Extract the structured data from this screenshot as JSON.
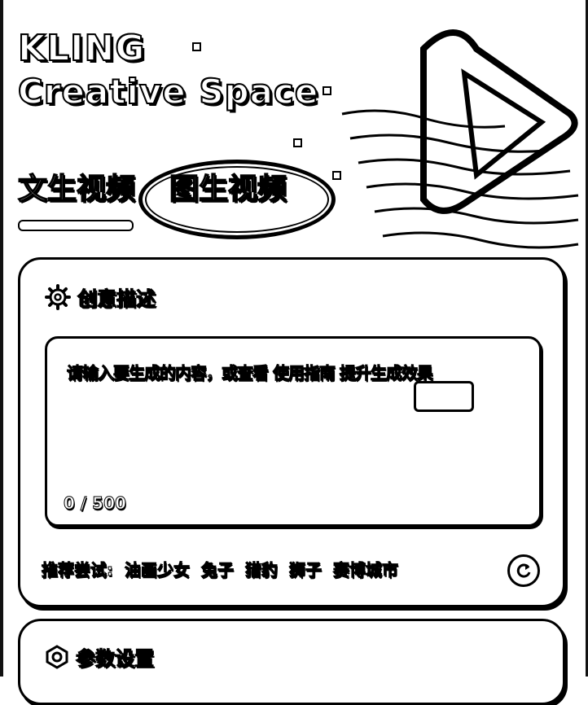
{
  "hero": {
    "logo_line1": "KLING",
    "logo_line2": "Creative Space"
  },
  "tabs": [
    {
      "label": "文生视频",
      "active": true
    },
    {
      "label": "图生视频",
      "active": false,
      "highlighted": true
    }
  ],
  "description_card": {
    "title": "创意描述",
    "icon": "gear-icon",
    "prompt": {
      "placeholder": "请输入要生成的内容，或查看 使用指南 提升生成效果",
      "value": "",
      "char_count": "0 / 500"
    },
    "suggestions": {
      "label": "推荐尝试:",
      "items": [
        "油画少女",
        "兔子",
        "猎豹",
        "狮子",
        "赛博城市"
      ]
    },
    "refresh_icon": "refresh-icon"
  },
  "params_card": {
    "title": "参数设置",
    "icon": "settings-icon"
  },
  "colors": {
    "background": "#ffffff",
    "outline": "#000000"
  }
}
